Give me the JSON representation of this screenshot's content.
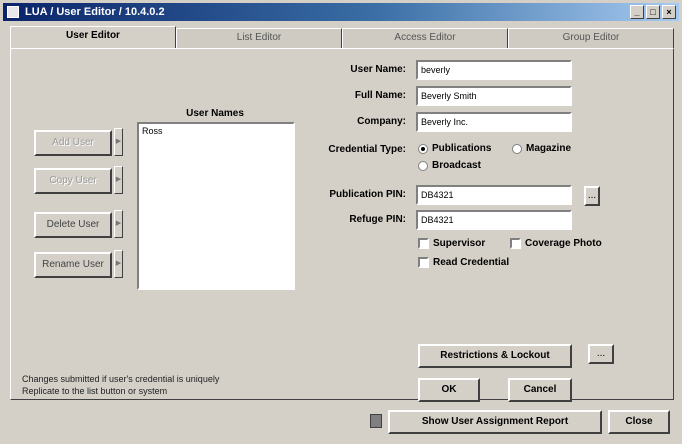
{
  "window": {
    "title": "LUA / User Editor / 10.4.0.2",
    "controls": [
      "_",
      "□",
      "×"
    ]
  },
  "tabs": [
    "User Editor",
    "List Editor",
    "Access Editor",
    "Group Editor"
  ],
  "user_list": {
    "header": "User Names",
    "items": [
      "Ross"
    ]
  },
  "left_buttons": [
    "Add User",
    "Copy User",
    "Delete User",
    "Rename User"
  ],
  "form": {
    "user_name_label": "User Name:",
    "user_name_value": "beverly",
    "full_name_label": "Full Name:",
    "full_name_value": "Beverly Smith",
    "company_label": "Company:",
    "company_value": "Beverly Inc.",
    "credential_type_label": "Credential Type:",
    "credential_options": [
      "Publications",
      "Magazine",
      "Broadcast"
    ],
    "selected_credential": "Publications",
    "pub_pin_label": "Publication PIN:",
    "pub_pin_value": "DB4321",
    "refuge_pin_label": "Refuge PIN:",
    "refuge_pin_value": "DB4321",
    "ellipsis_label": "...",
    "checkboxes": [
      "Supervisor",
      "Coverage Photo",
      "Read Credential"
    ]
  },
  "restrictions_button": "Restrictions & Lockout",
  "restrictions_more": "...",
  "note_lines": [
    "Changes submitted if user's credential is uniquely",
    "Replicate to the list button or system"
  ],
  "ok_label": "OK",
  "cancel_label": "Cancel",
  "statusbar": {
    "report_button": "Show User Assignment Report",
    "close_button": "Close"
  }
}
